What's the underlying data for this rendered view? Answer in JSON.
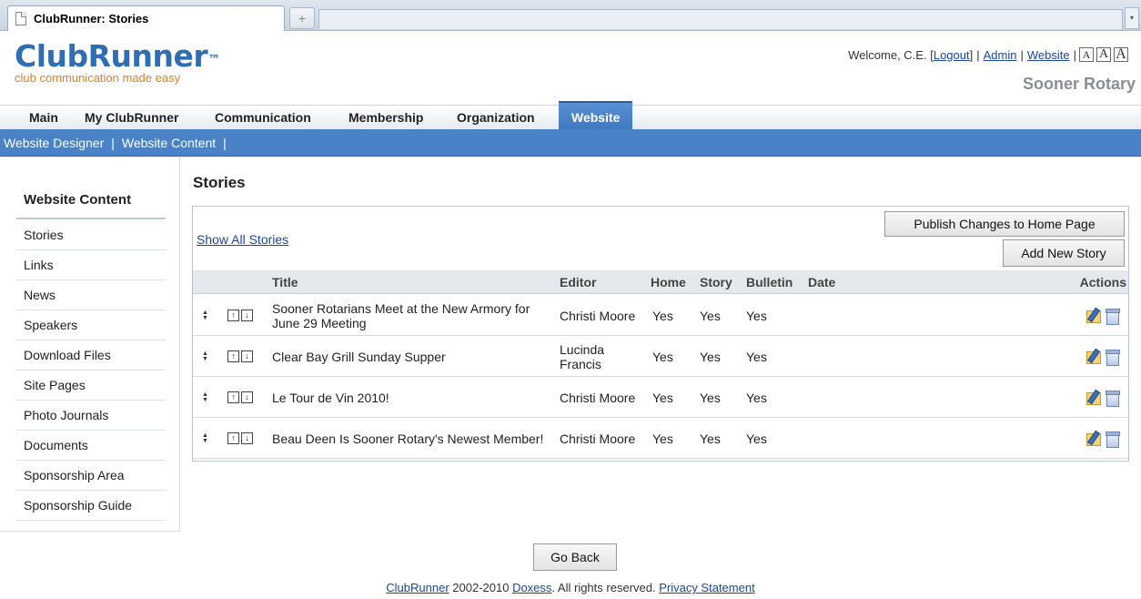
{
  "browser": {
    "tab_title": "ClubRunner: Stories",
    "new_tab_glyph": "+",
    "dropdown_glyph": "▾"
  },
  "header": {
    "brand": "ClubRunner",
    "trademark": "™",
    "tagline": "club communication made easy",
    "welcome_text": "Welcome, C.E.",
    "logout_open": "[",
    "logout_label": "Logout",
    "logout_close": "]",
    "admin_label": "Admin",
    "website_label": "Website",
    "separator": "|",
    "font_sizes": [
      "A",
      "A",
      "A"
    ],
    "club_name": "Sooner Rotary"
  },
  "nav": {
    "items": [
      "Main",
      "My ClubRunner",
      "Communication",
      "Membership",
      "Organization",
      "Website"
    ],
    "active": "Website",
    "sub_items": [
      "Website Designer",
      "Website Content"
    ],
    "separator": "|"
  },
  "sidebar": {
    "heading": "Website Content",
    "items": [
      "Stories",
      "Links",
      "News",
      "Speakers",
      "Download Files",
      "Site Pages",
      "Photo Journals",
      "Documents",
      "Sponsorship Area",
      "Sponsorship Guide"
    ]
  },
  "main": {
    "title": "Stories",
    "show_all_label": "Show All Stories",
    "publish_label": "Publish Changes to Home Page",
    "add_label": "Add New Story",
    "columns": {
      "title": "Title",
      "editor": "Editor",
      "home": "Home",
      "story": "Story",
      "bulletin": "Bulletin",
      "date": "Date",
      "actions": "Actions"
    },
    "rows": [
      {
        "title": "Sooner Rotarians Meet at the New Armory for June 29 Meeting",
        "editor": "Christi Moore",
        "home": "Yes",
        "story": "Yes",
        "bulletin": "Yes",
        "date": ""
      },
      {
        "title": "Clear Bay Grill Sunday Supper",
        "editor": "Lucinda Francis",
        "home": "Yes",
        "story": "Yes",
        "bulletin": "Yes",
        "date": ""
      },
      {
        "title": "Le Tour de Vin 2010!",
        "editor": "Christi Moore",
        "home": "Yes",
        "story": "Yes",
        "bulletin": "Yes",
        "date": ""
      },
      {
        "title": "Beau Deen Is Sooner Rotary's Newest Member!",
        "editor": "Christi Moore",
        "home": "Yes",
        "story": "Yes",
        "bulletin": "Yes",
        "date": ""
      }
    ],
    "icons": {
      "sort": "sort-arrows-icon",
      "move_up": "move-up-icon",
      "move_down": "move-down-icon",
      "edit": "edit-icon",
      "delete": "delete-icon"
    },
    "glyphs": {
      "sort_up": "▲",
      "sort_down": "▼",
      "move_up": "↑",
      "move_down": "↓"
    }
  },
  "footer": {
    "back_label": "Go Back",
    "clubrunner_link": "ClubRunner",
    "years": " 2002-2010 ",
    "doxess_link": "Doxess",
    "rights": ". All rights reserved. ",
    "privacy_link": "Privacy Statement"
  }
}
